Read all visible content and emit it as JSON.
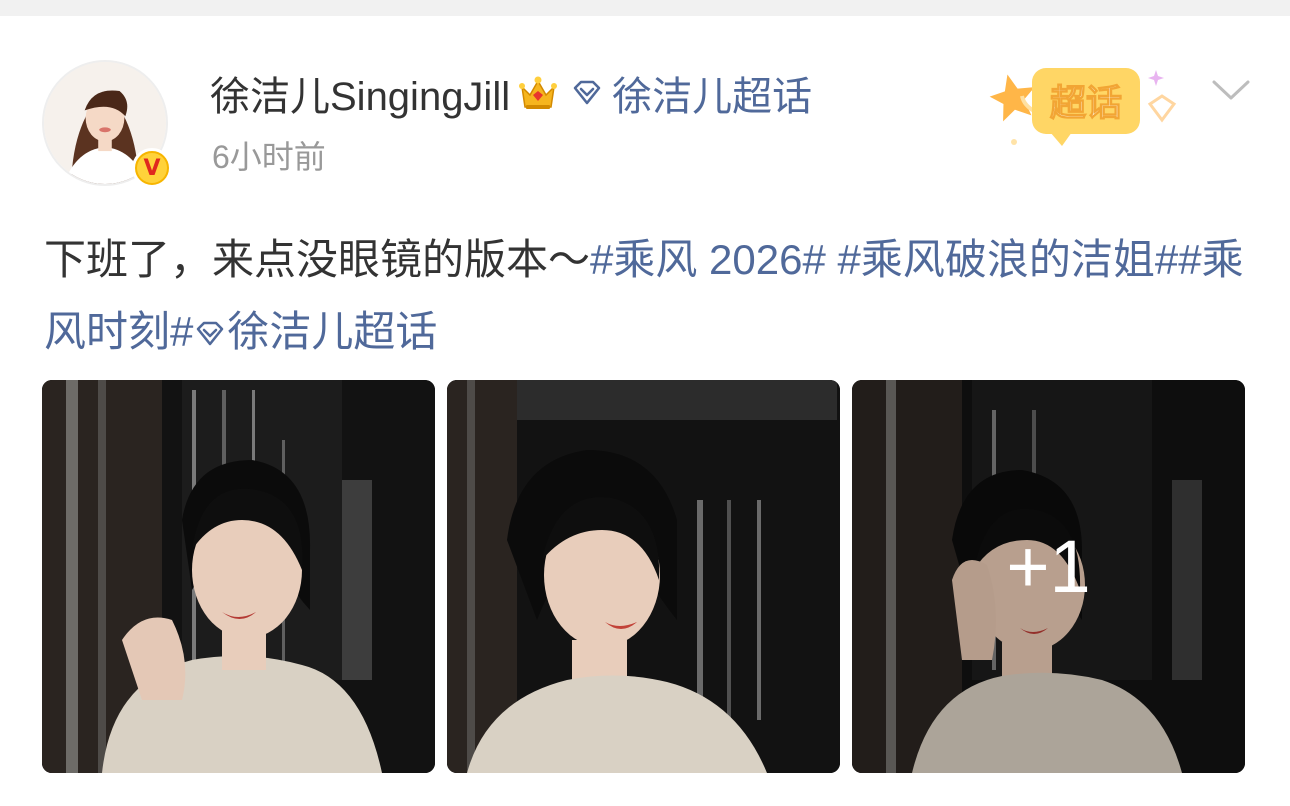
{
  "post": {
    "author": {
      "name": "徐洁儿SingingJill",
      "verified_icon": "v-verified-badge-icon",
      "member_icon": "crown-icon",
      "supertopic_icon": "diamond-icon",
      "supertopic_label": "徐洁儿超话"
    },
    "time": "6小时前",
    "sticker_label": "超话",
    "text": {
      "plain": "下班了，来点没眼镜的版本～",
      "tags": [
        "#乘风 2026#",
        " #乘风破浪的洁姐#",
        "#乘风时刻#"
      ],
      "supertopic_link": "徐洁儿超话"
    },
    "images": {
      "count_visible": 3,
      "more_label": "+1"
    }
  },
  "colors": {
    "link": "#50699a",
    "text": "#333333",
    "muted": "#999999",
    "accent_yellow": "#f7b500"
  }
}
